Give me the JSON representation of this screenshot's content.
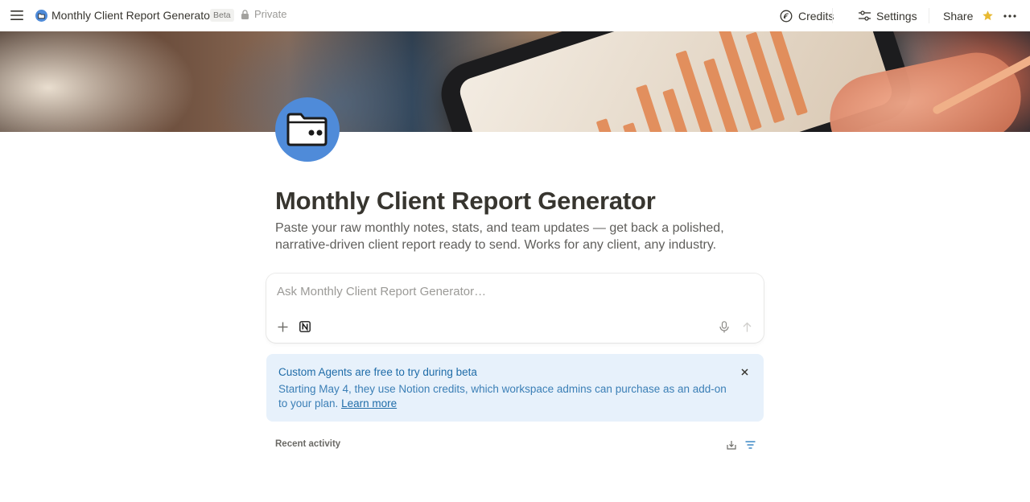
{
  "topbar": {
    "menu_icon": "hamburger-icon",
    "page_icon": "folder-icon",
    "title": "Monthly Client Report Generator",
    "badge": "Beta",
    "privacy_icon": "lock-icon",
    "privacy": "Private",
    "credits_label": "Credits",
    "credits_icon": "credits-icon",
    "settings_label": "Settings",
    "settings_icon": "sliders-icon",
    "share_label": "Share",
    "favorite_icon": "star-icon",
    "more_icon": "more-horizontal-icon",
    "favorite_color": "#e8b931"
  },
  "page": {
    "icon": "folder-icon",
    "icon_bg": "#4f8bd9",
    "title": "Monthly Client Report Generator",
    "description": "Paste your raw monthly notes, stats, and team updates — get back a polished, narrative-driven client report ready to send. Works for any client, any industry."
  },
  "ask": {
    "placeholder": "Ask Monthly Client Report Generator…",
    "value": "",
    "tools": [
      "plus-icon",
      "notion-icon",
      "microphone-icon",
      "arrow-up-icon"
    ]
  },
  "callout": {
    "title": "Custom Agents are free to try during beta",
    "body": "Starting May 4, they use Notion credits, which workspace admins can purchase as an add-on to your plan.",
    "link": "Learn more",
    "close_icon": "close-icon",
    "bg_color": "#e7f1fb",
    "text_color": "#1f6ca8"
  },
  "recent": {
    "label": "Recent activity",
    "actions": [
      "export-icon",
      "filter-icon"
    ]
  }
}
